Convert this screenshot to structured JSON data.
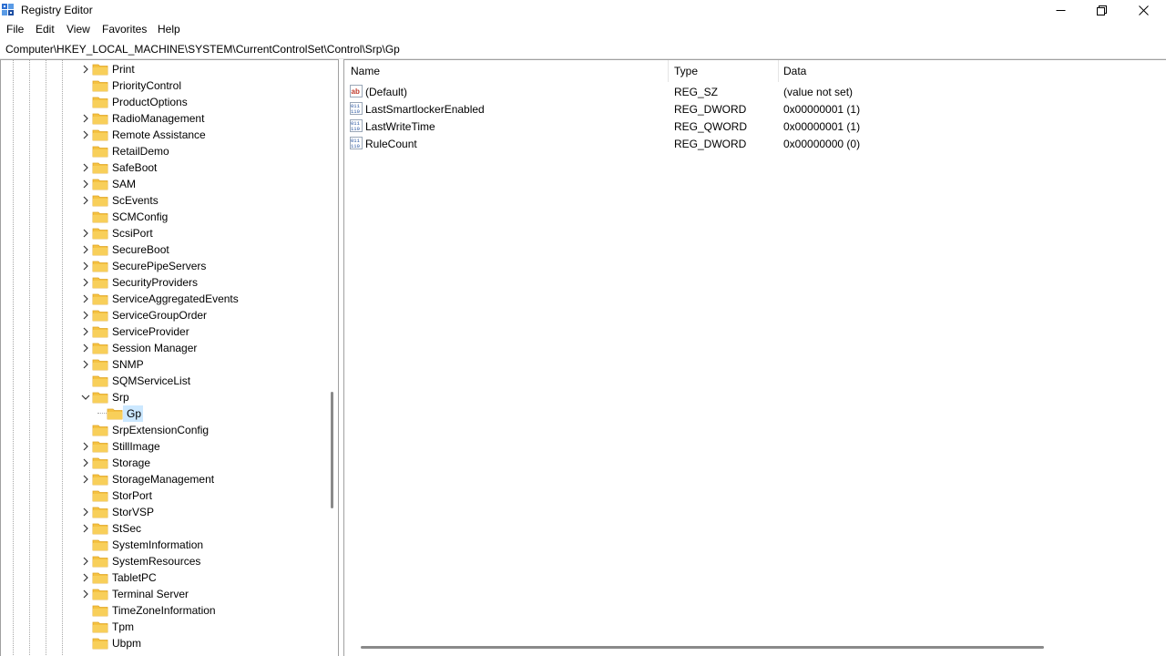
{
  "window": {
    "title": "Registry Editor"
  },
  "menu": [
    "File",
    "Edit",
    "View",
    "Favorites",
    "Help"
  ],
  "address": "Computer\\HKEY_LOCAL_MACHINE\\SYSTEM\\CurrentControlSet\\Control\\Srp\\Gp",
  "tree": {
    "items": [
      {
        "label": "Print",
        "expandable": true
      },
      {
        "label": "PriorityControl",
        "expandable": false
      },
      {
        "label": "ProductOptions",
        "expandable": false
      },
      {
        "label": "RadioManagement",
        "expandable": true
      },
      {
        "label": "Remote Assistance",
        "expandable": true
      },
      {
        "label": "RetailDemo",
        "expandable": false
      },
      {
        "label": "SafeBoot",
        "expandable": true
      },
      {
        "label": "SAM",
        "expandable": true
      },
      {
        "label": "ScEvents",
        "expandable": true
      },
      {
        "label": "SCMConfig",
        "expandable": false
      },
      {
        "label": "ScsiPort",
        "expandable": true
      },
      {
        "label": "SecureBoot",
        "expandable": true
      },
      {
        "label": "SecurePipeServers",
        "expandable": true
      },
      {
        "label": "SecurityProviders",
        "expandable": true
      },
      {
        "label": "ServiceAggregatedEvents",
        "expandable": true
      },
      {
        "label": "ServiceGroupOrder",
        "expandable": true
      },
      {
        "label": "ServiceProvider",
        "expandable": true
      },
      {
        "label": "Session Manager",
        "expandable": true
      },
      {
        "label": "SNMP",
        "expandable": true
      },
      {
        "label": "SQMServiceList",
        "expandable": false
      },
      {
        "label": "Srp",
        "expandable": true,
        "expanded": true
      },
      {
        "label": "Gp",
        "child": true,
        "selected": true
      },
      {
        "label": "SrpExtensionConfig",
        "expandable": false
      },
      {
        "label": "StillImage",
        "expandable": true
      },
      {
        "label": "Storage",
        "expandable": true
      },
      {
        "label": "StorageManagement",
        "expandable": true
      },
      {
        "label": "StorPort",
        "expandable": false
      },
      {
        "label": "StorVSP",
        "expandable": true
      },
      {
        "label": "StSec",
        "expandable": true
      },
      {
        "label": "SystemInformation",
        "expandable": false
      },
      {
        "label": "SystemResources",
        "expandable": true
      },
      {
        "label": "TabletPC",
        "expandable": true
      },
      {
        "label": "Terminal Server",
        "expandable": true
      },
      {
        "label": "TimeZoneInformation",
        "expandable": false
      },
      {
        "label": "Tpm",
        "expandable": false
      },
      {
        "label": "Ubpm",
        "expandable": false
      }
    ]
  },
  "values": {
    "columns": {
      "name": "Name",
      "type": "Type",
      "data": "Data"
    },
    "rows": [
      {
        "name": "(Default)",
        "type": "REG_SZ",
        "data": "(value not set)",
        "icon": "string-value-icon"
      },
      {
        "name": "LastSmartlockerEnabled",
        "type": "REG_DWORD",
        "data": "0x00000001 (1)",
        "icon": "binary-value-icon"
      },
      {
        "name": "LastWriteTime",
        "type": "REG_QWORD",
        "data": "0x00000001 (1)",
        "icon": "binary-value-icon"
      },
      {
        "name": "RuleCount",
        "type": "REG_DWORD",
        "data": "0x00000000 (0)",
        "icon": "binary-value-icon"
      }
    ]
  },
  "colors": {
    "selection": "#cce8ff",
    "folder": "#f5c242",
    "folder_dark": "#e0a526"
  }
}
